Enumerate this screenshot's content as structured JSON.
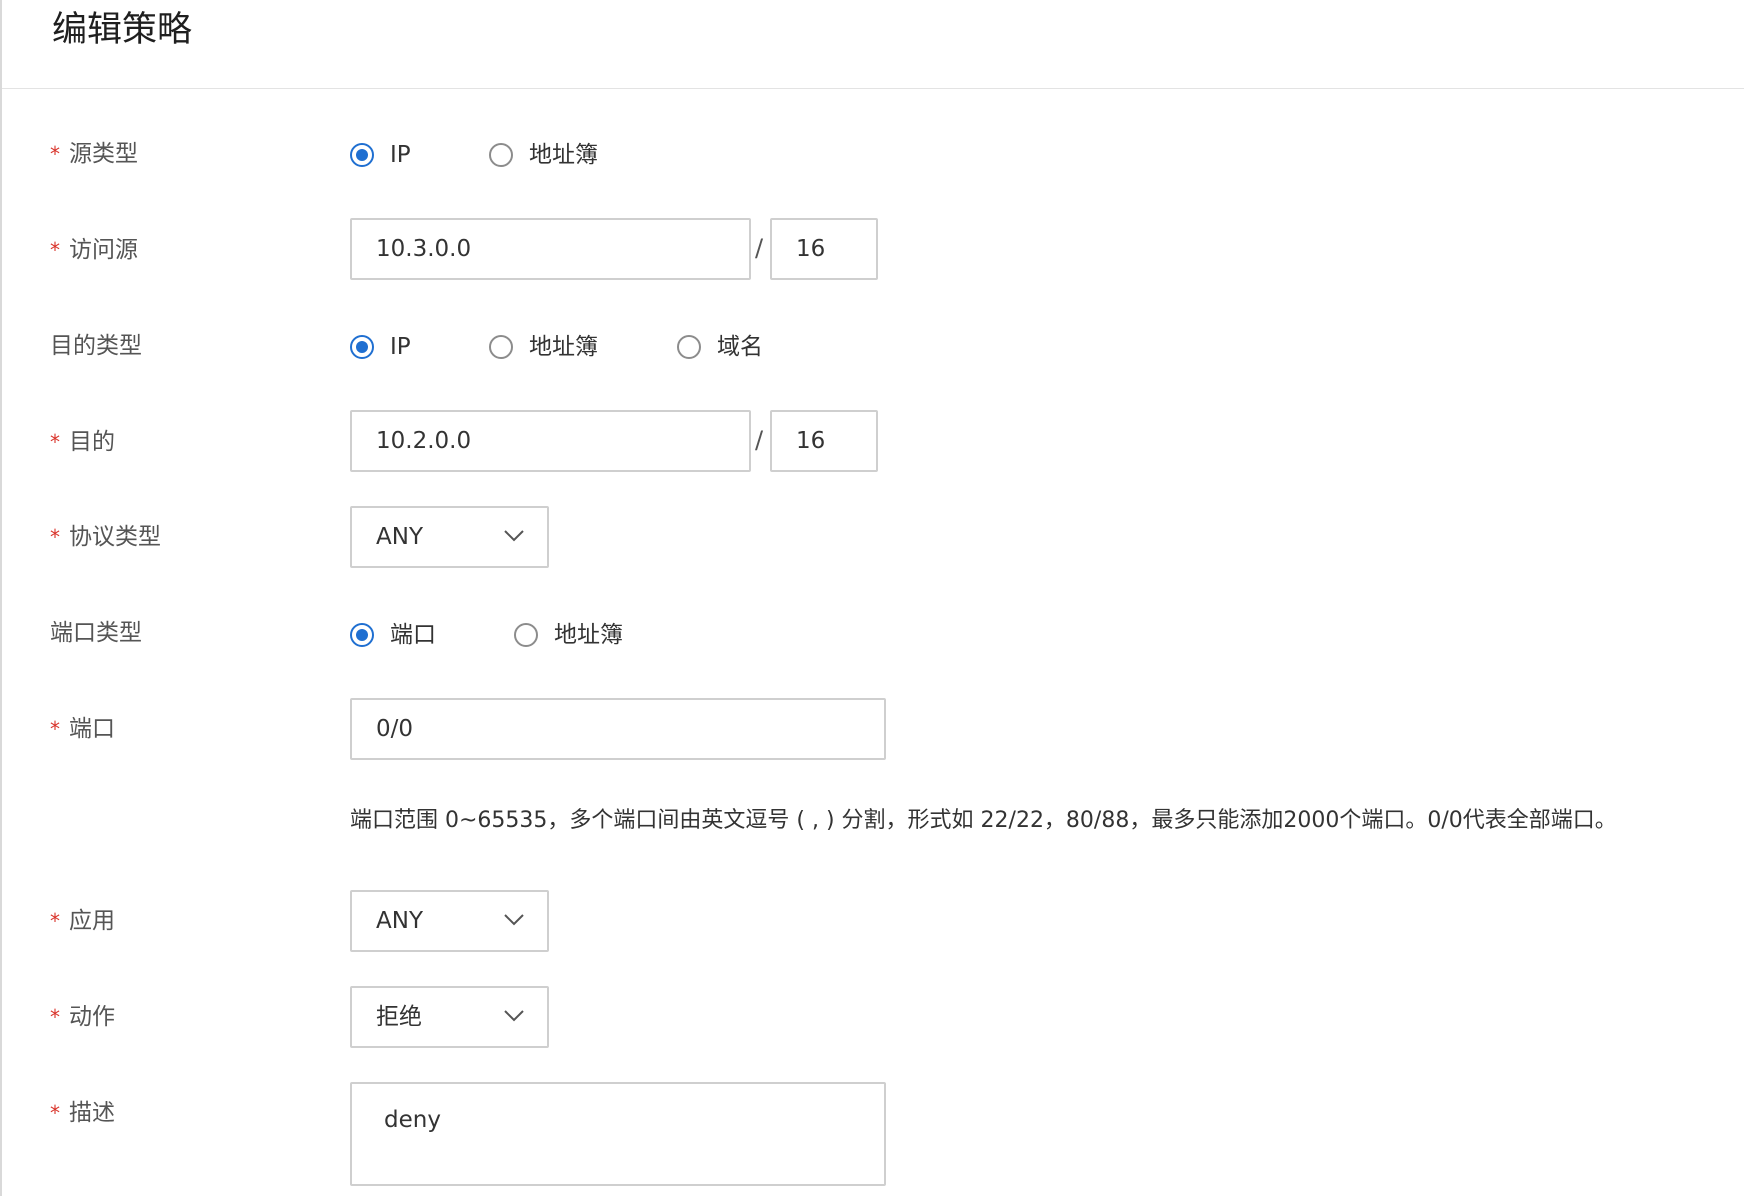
{
  "header": {
    "title": "编辑策略"
  },
  "required_mark": "*",
  "source_type": {
    "label": "源类型",
    "options": [
      {
        "label": "IP",
        "checked": true
      },
      {
        "label": "地址簿",
        "checked": false
      }
    ]
  },
  "source": {
    "label": "访问源",
    "ip": "10.3.0.0",
    "separator": "/",
    "mask": "16"
  },
  "dest_type": {
    "label": "目的类型",
    "options": [
      {
        "label": "IP",
        "checked": true
      },
      {
        "label": "地址簿",
        "checked": false
      },
      {
        "label": "域名",
        "checked": false
      }
    ]
  },
  "dest": {
    "label": "目的",
    "ip": "10.2.0.0",
    "separator": "/",
    "mask": "16"
  },
  "protocol": {
    "label": "协议类型",
    "value": "ANY"
  },
  "port_type": {
    "label": "端口类型",
    "options": [
      {
        "label": "端口",
        "checked": true
      },
      {
        "label": "地址簿",
        "checked": false
      }
    ]
  },
  "port": {
    "label": "端口",
    "value": "0/0",
    "hint": "端口范围 0~65535，多个端口间由英文逗号 ( , ) 分割，形式如 22/22，80/88，最多只能添加2000个端口。0/0代表全部端口。"
  },
  "application": {
    "label": "应用",
    "value": "ANY"
  },
  "action": {
    "label": "动作",
    "value": "拒绝"
  },
  "description": {
    "label": "描述",
    "value": "deny"
  },
  "colors": {
    "accent": "#1f6fd1",
    "required": "#d9342b",
    "border": "#cfcfcf"
  }
}
